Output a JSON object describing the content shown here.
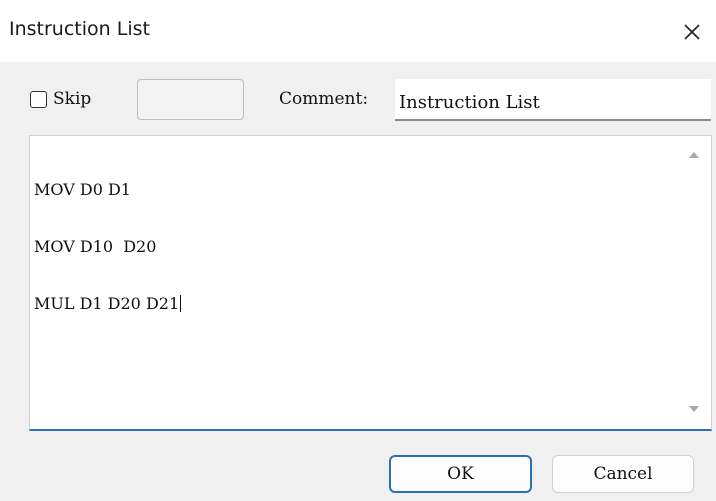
{
  "window": {
    "title": "Instruction List",
    "close_icon": "close-icon"
  },
  "form": {
    "skip_label": "Skip",
    "skip_checked": false,
    "skip_value": "",
    "comment_label": "Comment:",
    "comment_value": "Instruction List"
  },
  "editor": {
    "lines": [
      "MOV D0 D1",
      "MOV D10  D20",
      "MUL D1 D20 D21"
    ],
    "scroll_up_icon": "triangle-up-icon",
    "scroll_down_icon": "triangle-down-icon"
  },
  "buttons": {
    "ok_label": "OK",
    "cancel_label": "Cancel"
  },
  "colors": {
    "accent": "#2d6fb6",
    "dialog_bg": "#f0f0f0"
  }
}
